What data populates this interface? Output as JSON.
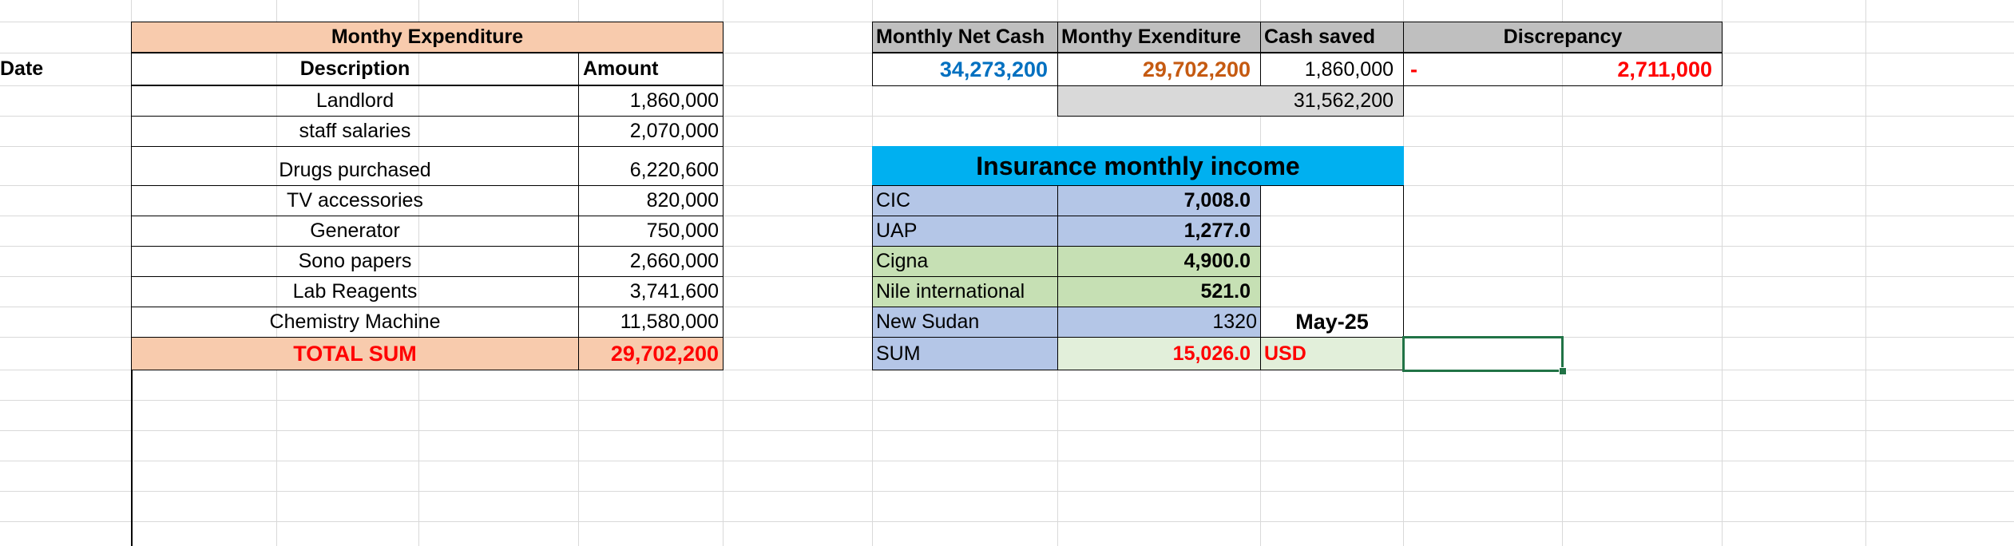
{
  "colors": {
    "accent_red": "#ff0000",
    "net_cash_blue": "#0070c0",
    "expenditure_orange": "#c55a11",
    "header_peach": "#f8cbad",
    "header_grey": "#bfbfbf",
    "insurance_cyan": "#00b0f0",
    "selection_green": "#217346"
  },
  "expenditure": {
    "title": "Monthy Expenditure",
    "headers": {
      "date": "Date",
      "description": "Description",
      "amount": "Amount"
    },
    "rows": [
      {
        "description": "Landlord",
        "amount": "1,860,000"
      },
      {
        "description": "staff salaries",
        "amount": "2,070,000"
      },
      {
        "description": "Drugs purchased",
        "amount": "6,220,600"
      },
      {
        "description": "TV accessories",
        "amount": "820,000"
      },
      {
        "description": "Generator",
        "amount": "750,000"
      },
      {
        "description": "Sono papers",
        "amount": "2,660,000"
      },
      {
        "description": "Lab Reagents",
        "amount": "3,741,600"
      },
      {
        "description": "Chemistry Machine",
        "amount": "11,580,000"
      }
    ],
    "total": {
      "label": "TOTAL SUM",
      "amount": "29,702,200"
    }
  },
  "summary": {
    "headers": {
      "net_cash": "Monthly Net Cash",
      "expenditure": "Monthy Exenditure",
      "cash_saved": "Cash saved",
      "discrepancy": "Discrepancy"
    },
    "values": {
      "net_cash": "34,273,200",
      "expenditure": "29,702,200",
      "cash_saved": "1,860,000",
      "discrepancy_sign": "-",
      "discrepancy": "2,711,000",
      "sum_below": "31,562,200"
    }
  },
  "insurance": {
    "title": "Insurance monthly income",
    "rows": [
      {
        "name": "CIC",
        "amount": "7,008.0"
      },
      {
        "name": "UAP",
        "amount": "1,277.0"
      },
      {
        "name": "Cigna",
        "amount": "4,900.0"
      },
      {
        "name": "Nile international",
        "amount": "521.0"
      },
      {
        "name": "New Sudan",
        "amount": "1320"
      }
    ],
    "month": "May-25",
    "sum": {
      "label": "SUM",
      "amount": "15,026.0",
      "currency": "USD"
    }
  }
}
